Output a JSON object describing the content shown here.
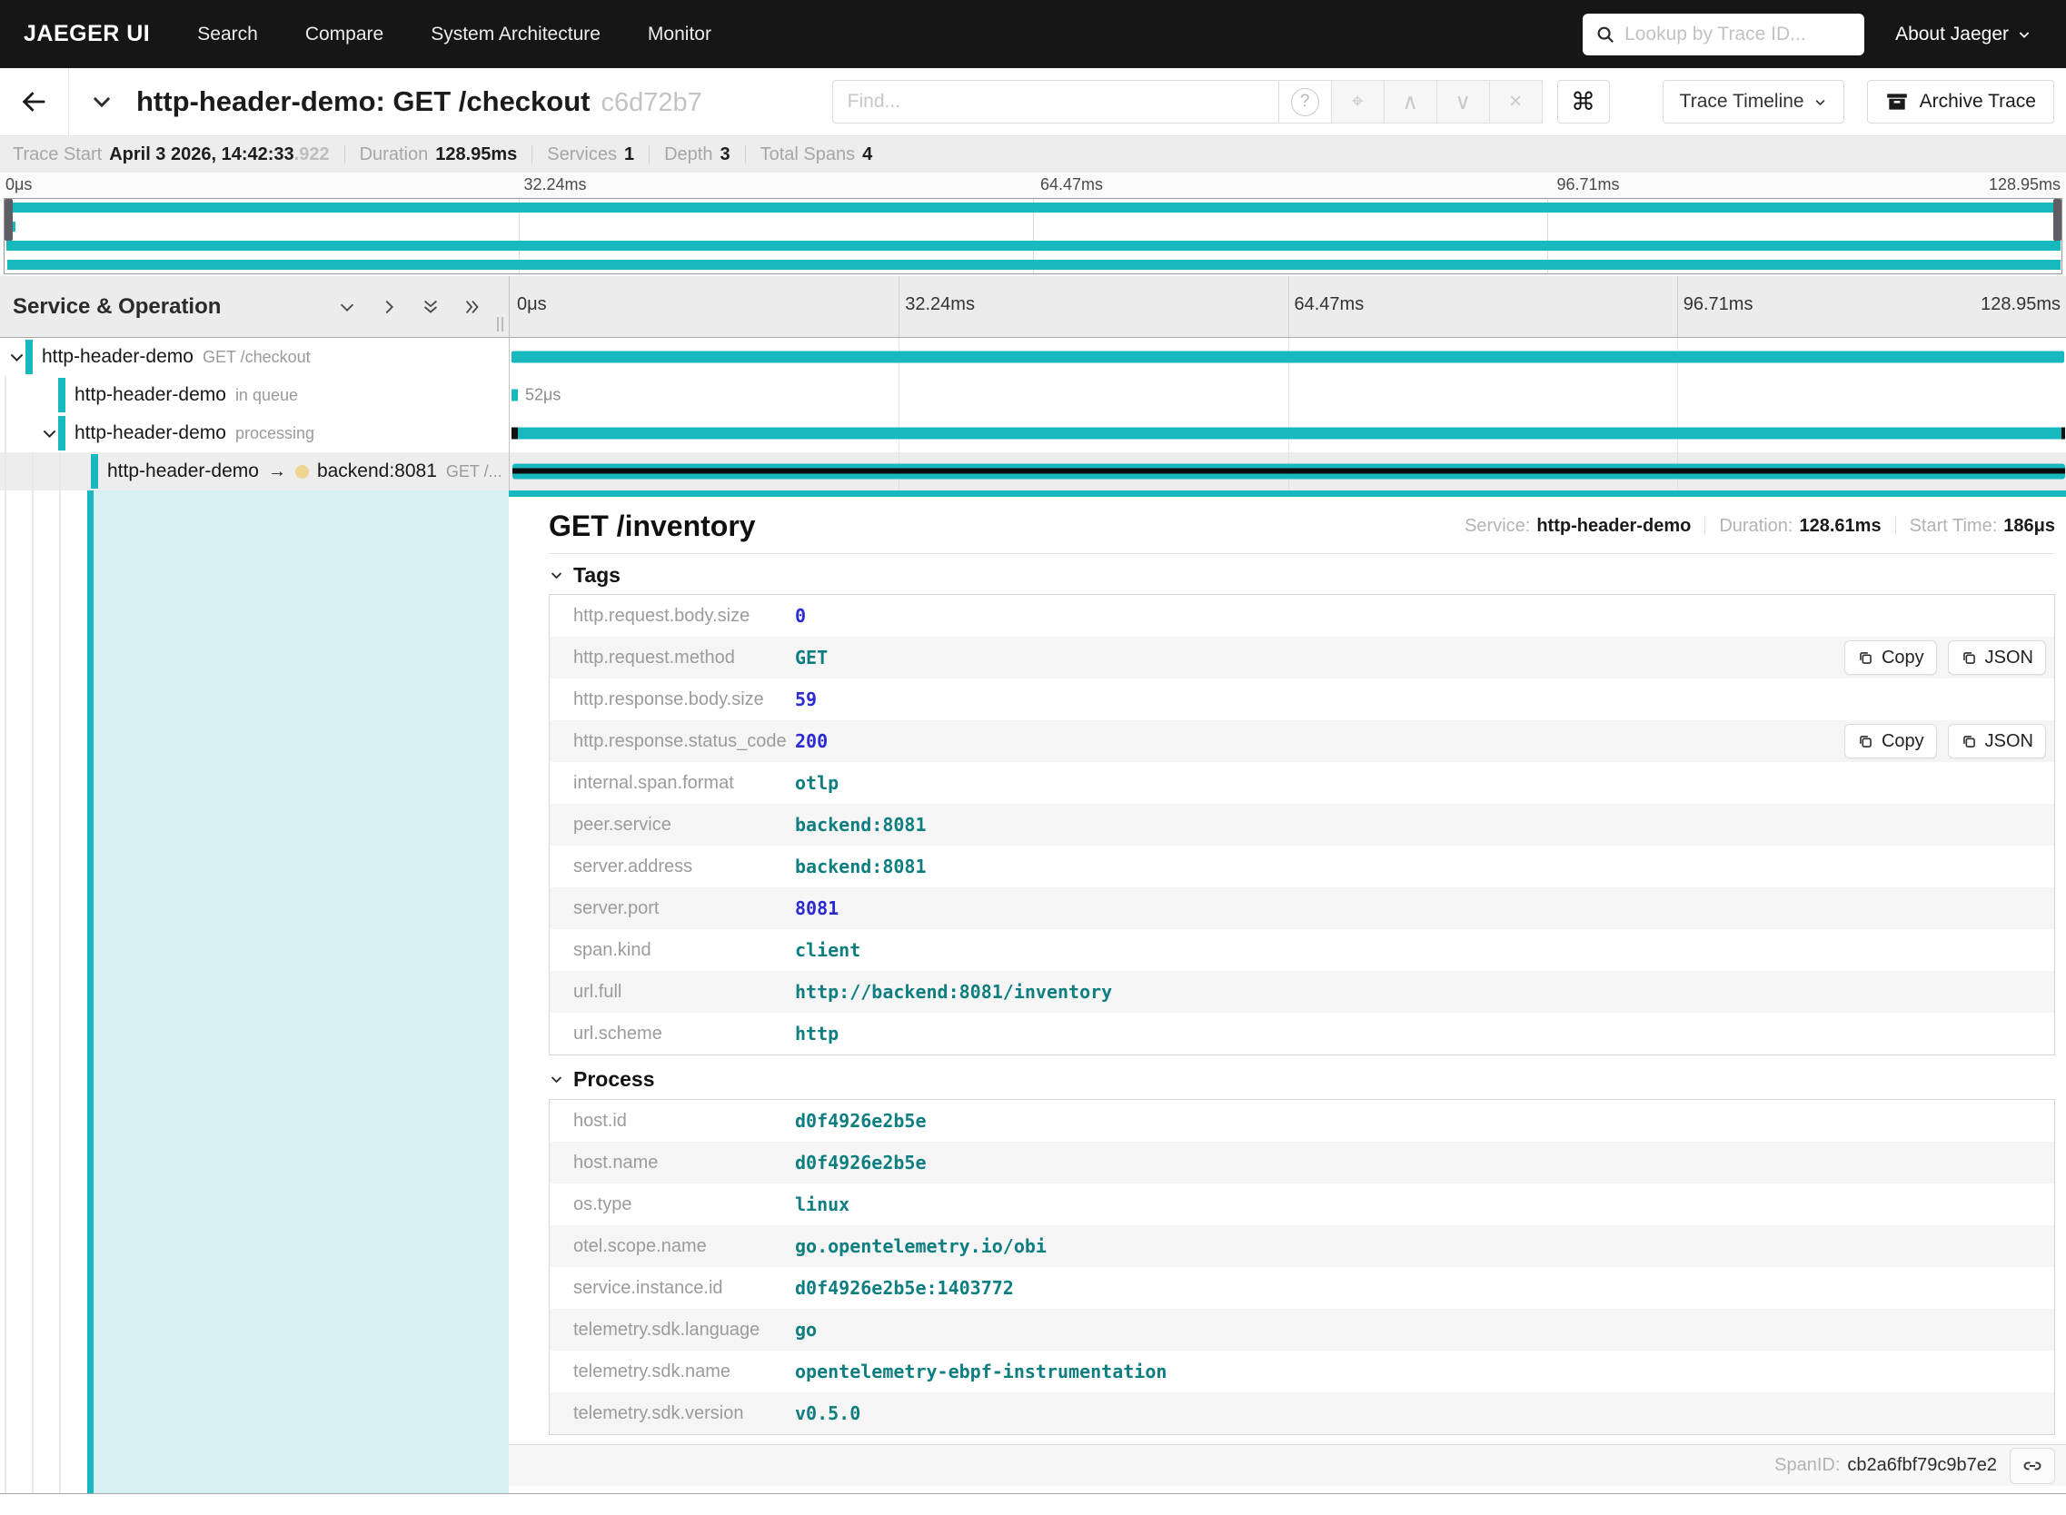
{
  "colors": {
    "accent_teal": "#17b8be",
    "selected_span_cyan": "#d7f0f3",
    "peer_dot_wheat": "#efd492",
    "number_value": "#2b2bd1",
    "string_value": "#0e7e80",
    "navbar_bg": "#161616"
  },
  "navbar": {
    "brand": "JAEGER UI",
    "items": [
      "Search",
      "Compare",
      "System Architecture",
      "Monitor"
    ],
    "lookup_placeholder": "Lookup by Trace ID...",
    "about_label": "About Jaeger"
  },
  "titlebar": {
    "title": "http-header-demo: GET /checkout",
    "trace_id_short": "c6d72b7",
    "find_placeholder": "Find...",
    "view_select_label": "Trace Timeline",
    "archive_label": "Archive Trace"
  },
  "infobar": {
    "trace_start_label": "Trace Start",
    "trace_start_value": "April 3 2026, 14:42:33",
    "trace_start_ms": ".922",
    "duration_label": "Duration",
    "duration_value": "128.95ms",
    "services_label": "Services",
    "services_value": "1",
    "depth_label": "Depth",
    "depth_value": "3",
    "total_spans_label": "Total Spans",
    "total_spans_value": "4"
  },
  "timeline": {
    "header_left": "Service & Operation",
    "ticks": [
      "0μs",
      "32.24ms",
      "64.47ms",
      "96.71ms",
      "128.95ms"
    ]
  },
  "spans": [
    {
      "service": "http-header-demo",
      "operation": "GET /checkout",
      "bar": {
        "left": 0.1,
        "width": 99.8
      }
    },
    {
      "service": "http-header-demo",
      "operation": "in queue",
      "bar": {
        "left": 0.1,
        "width": 0.42
      },
      "duration_label": "52μs"
    },
    {
      "service": "http-header-demo",
      "operation": "processing",
      "bar": {
        "left": 0.1,
        "width": 99.85
      }
    },
    {
      "service": "http-header-demo",
      "operation": "GET /...",
      "peer": "backend:8081",
      "bar": {
        "left": 0.15,
        "width": 99.8
      }
    }
  ],
  "detail": {
    "title": "GET /inventory",
    "service_label": "Service:",
    "service": "http-header-demo",
    "duration_label": "Duration:",
    "duration": "128.61ms",
    "start_label": "Start Time:",
    "start": "186μs",
    "tags_label": "Tags",
    "process_label": "Process",
    "copy_label": "Copy",
    "json_label": "JSON",
    "tags": [
      {
        "key": "http.request.body.size",
        "value": "0",
        "type": "number",
        "actions": false
      },
      {
        "key": "http.request.method",
        "value": "GET",
        "type": "string",
        "actions": true
      },
      {
        "key": "http.response.body.size",
        "value": "59",
        "type": "number",
        "actions": false
      },
      {
        "key": "http.response.status_code",
        "value": "200",
        "type": "number",
        "actions": true
      },
      {
        "key": "internal.span.format",
        "value": "otlp",
        "type": "string",
        "actions": false
      },
      {
        "key": "peer.service",
        "value": "backend:8081",
        "type": "string",
        "actions": false
      },
      {
        "key": "server.address",
        "value": "backend:8081",
        "type": "string",
        "actions": false
      },
      {
        "key": "server.port",
        "value": "8081",
        "type": "number",
        "actions": false
      },
      {
        "key": "span.kind",
        "value": "client",
        "type": "string",
        "actions": false
      },
      {
        "key": "url.full",
        "value": "http://backend:8081/inventory",
        "type": "string",
        "actions": false
      },
      {
        "key": "url.scheme",
        "value": "http",
        "type": "string",
        "actions": false
      }
    ],
    "process": [
      {
        "key": "host.id",
        "value": "d0f4926e2b5e",
        "type": "string",
        "actions": false
      },
      {
        "key": "host.name",
        "value": "d0f4926e2b5e",
        "type": "string",
        "actions": false
      },
      {
        "key": "os.type",
        "value": "linux",
        "type": "string",
        "actions": false
      },
      {
        "key": "otel.scope.name",
        "value": "go.opentelemetry.io/obi",
        "type": "string",
        "actions": false
      },
      {
        "key": "service.instance.id",
        "value": "d0f4926e2b5e:1403772",
        "type": "string",
        "actions": false
      },
      {
        "key": "telemetry.sdk.language",
        "value": "go",
        "type": "string",
        "actions": false
      },
      {
        "key": "telemetry.sdk.name",
        "value": "opentelemetry-ebpf-instrumentation",
        "type": "string",
        "actions": false
      },
      {
        "key": "telemetry.sdk.version",
        "value": "v0.5.0",
        "type": "string",
        "actions": false
      }
    ],
    "span_id_label": "SpanID:",
    "span_id": "cb2a6fbf79c9b7e2"
  }
}
